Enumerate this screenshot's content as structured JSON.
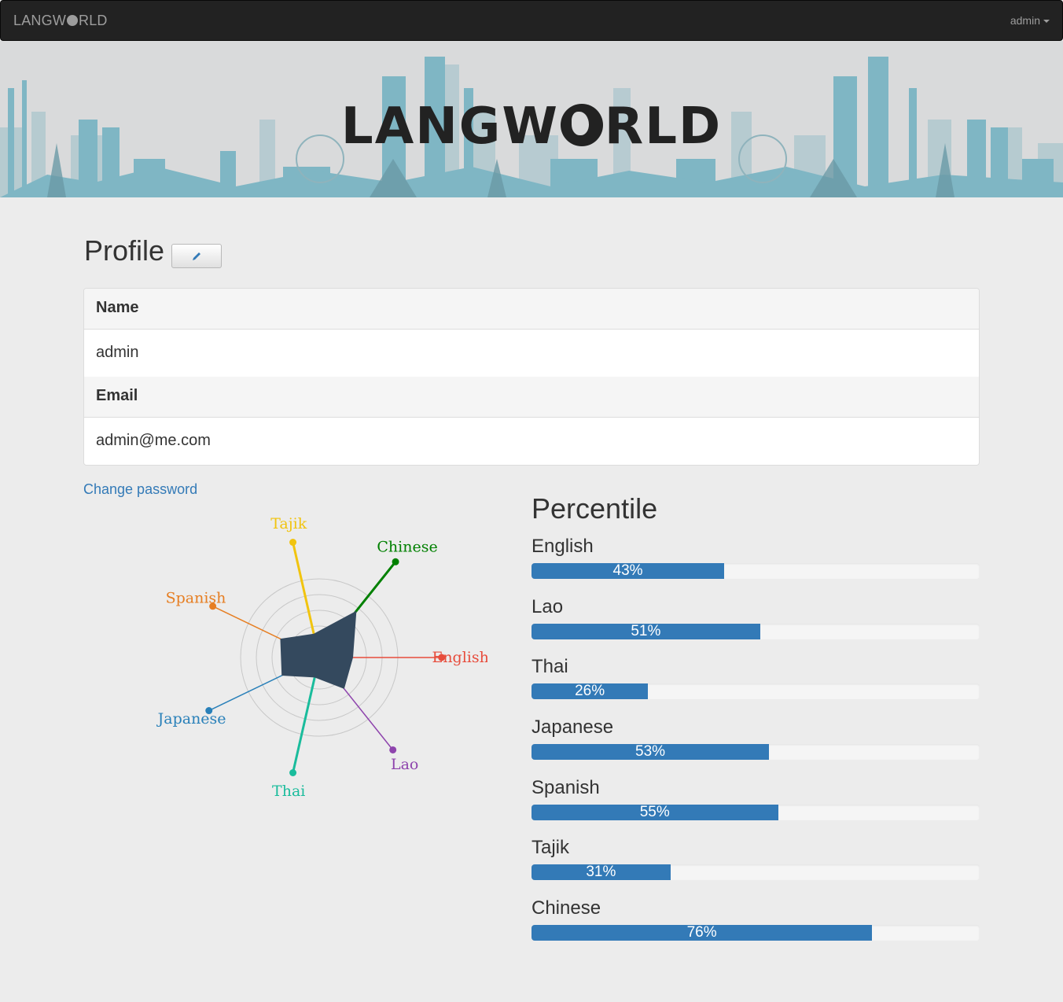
{
  "navbar": {
    "brand_pre": "LANGW",
    "brand_post": "RLD",
    "user_label": "admin"
  },
  "banner": {
    "logo_pre": "LANGW",
    "logo_post": "RLD"
  },
  "profile": {
    "title": "Profile",
    "name_header": "Name",
    "name_value": "admin",
    "email_header": "Email",
    "email_value": "admin@me.com",
    "change_password_label": "Change password"
  },
  "percentile": {
    "title": "Percentile",
    "items": [
      {
        "language": "English",
        "percent": 43,
        "label": "43%"
      },
      {
        "language": "Lao",
        "percent": 51,
        "label": "51%"
      },
      {
        "language": "Thai",
        "percent": 26,
        "label": "26%"
      },
      {
        "language": "Japanese",
        "percent": 53,
        "label": "53%"
      },
      {
        "language": "Spanish",
        "percent": 55,
        "label": "55%"
      },
      {
        "language": "Tajik",
        "percent": 31,
        "label": "31%"
      },
      {
        "language": "Chinese",
        "percent": 76,
        "label": "76%"
      }
    ]
  },
  "radar": {
    "fill_color": "#34495e",
    "axes": [
      {
        "label": "English",
        "color": "#e74c3c",
        "value": 0.43
      },
      {
        "label": "Lao",
        "color": "#8e44ad",
        "value": 0.51
      },
      {
        "label": "Thai",
        "color": "#1abc9c",
        "value": 0.26
      },
      {
        "label": "Japanese",
        "color": "#2980b9",
        "value": 0.53
      },
      {
        "label": "Spanish",
        "color": "#e67e22",
        "value": 0.55
      },
      {
        "label": "Tajik",
        "color": "#f1c40f",
        "value": 0.31
      },
      {
        "label": "Chinese",
        "color": "#008000",
        "value": 0.76
      }
    ]
  },
  "colors": {
    "accent": "#337ab7",
    "navbar_bg": "#222222",
    "banner_skyline": "#7fb6c4"
  }
}
